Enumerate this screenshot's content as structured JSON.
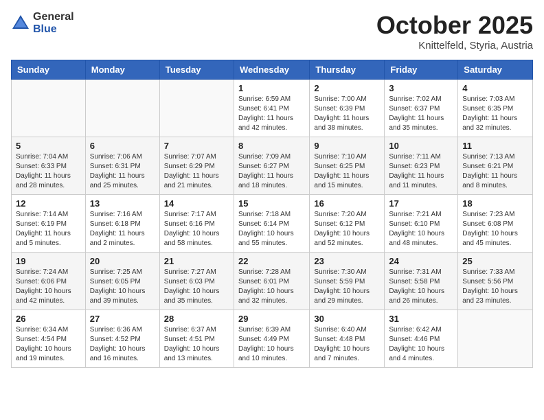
{
  "header": {
    "logo_general": "General",
    "logo_blue": "Blue",
    "month_title": "October 2025",
    "location": "Knittelfeld, Styria, Austria"
  },
  "weekdays": [
    "Sunday",
    "Monday",
    "Tuesday",
    "Wednesday",
    "Thursday",
    "Friday",
    "Saturday"
  ],
  "weeks": [
    [
      {
        "day": "",
        "info": ""
      },
      {
        "day": "",
        "info": ""
      },
      {
        "day": "",
        "info": ""
      },
      {
        "day": "1",
        "info": "Sunrise: 6:59 AM\nSunset: 6:41 PM\nDaylight: 11 hours\nand 42 minutes."
      },
      {
        "day": "2",
        "info": "Sunrise: 7:00 AM\nSunset: 6:39 PM\nDaylight: 11 hours\nand 38 minutes."
      },
      {
        "day": "3",
        "info": "Sunrise: 7:02 AM\nSunset: 6:37 PM\nDaylight: 11 hours\nand 35 minutes."
      },
      {
        "day": "4",
        "info": "Sunrise: 7:03 AM\nSunset: 6:35 PM\nDaylight: 11 hours\nand 32 minutes."
      }
    ],
    [
      {
        "day": "5",
        "info": "Sunrise: 7:04 AM\nSunset: 6:33 PM\nDaylight: 11 hours\nand 28 minutes."
      },
      {
        "day": "6",
        "info": "Sunrise: 7:06 AM\nSunset: 6:31 PM\nDaylight: 11 hours\nand 25 minutes."
      },
      {
        "day": "7",
        "info": "Sunrise: 7:07 AM\nSunset: 6:29 PM\nDaylight: 11 hours\nand 21 minutes."
      },
      {
        "day": "8",
        "info": "Sunrise: 7:09 AM\nSunset: 6:27 PM\nDaylight: 11 hours\nand 18 minutes."
      },
      {
        "day": "9",
        "info": "Sunrise: 7:10 AM\nSunset: 6:25 PM\nDaylight: 11 hours\nand 15 minutes."
      },
      {
        "day": "10",
        "info": "Sunrise: 7:11 AM\nSunset: 6:23 PM\nDaylight: 11 hours\nand 11 minutes."
      },
      {
        "day": "11",
        "info": "Sunrise: 7:13 AM\nSunset: 6:21 PM\nDaylight: 11 hours\nand 8 minutes."
      }
    ],
    [
      {
        "day": "12",
        "info": "Sunrise: 7:14 AM\nSunset: 6:19 PM\nDaylight: 11 hours\nand 5 minutes."
      },
      {
        "day": "13",
        "info": "Sunrise: 7:16 AM\nSunset: 6:18 PM\nDaylight: 11 hours\nand 2 minutes."
      },
      {
        "day": "14",
        "info": "Sunrise: 7:17 AM\nSunset: 6:16 PM\nDaylight: 10 hours\nand 58 minutes."
      },
      {
        "day": "15",
        "info": "Sunrise: 7:18 AM\nSunset: 6:14 PM\nDaylight: 10 hours\nand 55 minutes."
      },
      {
        "day": "16",
        "info": "Sunrise: 7:20 AM\nSunset: 6:12 PM\nDaylight: 10 hours\nand 52 minutes."
      },
      {
        "day": "17",
        "info": "Sunrise: 7:21 AM\nSunset: 6:10 PM\nDaylight: 10 hours\nand 48 minutes."
      },
      {
        "day": "18",
        "info": "Sunrise: 7:23 AM\nSunset: 6:08 PM\nDaylight: 10 hours\nand 45 minutes."
      }
    ],
    [
      {
        "day": "19",
        "info": "Sunrise: 7:24 AM\nSunset: 6:06 PM\nDaylight: 10 hours\nand 42 minutes."
      },
      {
        "day": "20",
        "info": "Sunrise: 7:25 AM\nSunset: 6:05 PM\nDaylight: 10 hours\nand 39 minutes."
      },
      {
        "day": "21",
        "info": "Sunrise: 7:27 AM\nSunset: 6:03 PM\nDaylight: 10 hours\nand 35 minutes."
      },
      {
        "day": "22",
        "info": "Sunrise: 7:28 AM\nSunset: 6:01 PM\nDaylight: 10 hours\nand 32 minutes."
      },
      {
        "day": "23",
        "info": "Sunrise: 7:30 AM\nSunset: 5:59 PM\nDaylight: 10 hours\nand 29 minutes."
      },
      {
        "day": "24",
        "info": "Sunrise: 7:31 AM\nSunset: 5:58 PM\nDaylight: 10 hours\nand 26 minutes."
      },
      {
        "day": "25",
        "info": "Sunrise: 7:33 AM\nSunset: 5:56 PM\nDaylight: 10 hours\nand 23 minutes."
      }
    ],
    [
      {
        "day": "26",
        "info": "Sunrise: 6:34 AM\nSunset: 4:54 PM\nDaylight: 10 hours\nand 19 minutes."
      },
      {
        "day": "27",
        "info": "Sunrise: 6:36 AM\nSunset: 4:52 PM\nDaylight: 10 hours\nand 16 minutes."
      },
      {
        "day": "28",
        "info": "Sunrise: 6:37 AM\nSunset: 4:51 PM\nDaylight: 10 hours\nand 13 minutes."
      },
      {
        "day": "29",
        "info": "Sunrise: 6:39 AM\nSunset: 4:49 PM\nDaylight: 10 hours\nand 10 minutes."
      },
      {
        "day": "30",
        "info": "Sunrise: 6:40 AM\nSunset: 4:48 PM\nDaylight: 10 hours\nand 7 minutes."
      },
      {
        "day": "31",
        "info": "Sunrise: 6:42 AM\nSunset: 4:46 PM\nDaylight: 10 hours\nand 4 minutes."
      },
      {
        "day": "",
        "info": ""
      }
    ]
  ]
}
